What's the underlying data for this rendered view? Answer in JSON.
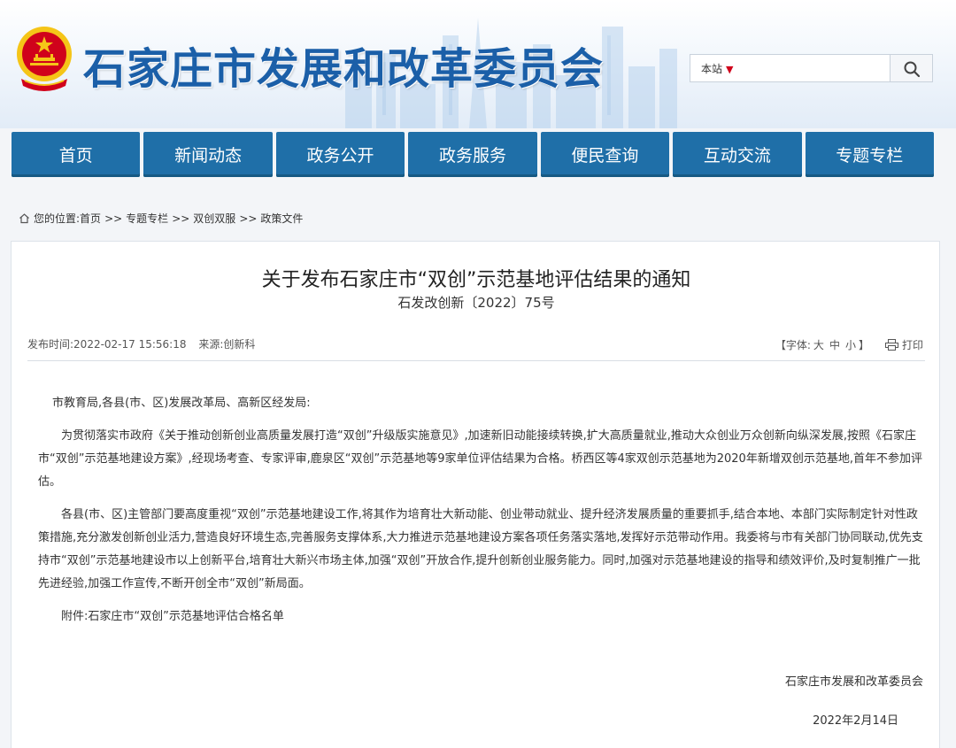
{
  "header": {
    "site_title": "石家庄市发展和改革委员会",
    "search": {
      "scope_label": "本站",
      "placeholder": ""
    }
  },
  "nav": {
    "items": [
      {
        "label": "首页"
      },
      {
        "label": "新闻动态"
      },
      {
        "label": "政务公开"
      },
      {
        "label": "政务服务"
      },
      {
        "label": "便民查询"
      },
      {
        "label": "互动交流"
      },
      {
        "label": "专题专栏"
      }
    ]
  },
  "breadcrumb": {
    "prefix": "您的位置:",
    "items": [
      "首页",
      "专题专栏",
      "双创双服",
      "政策文件"
    ],
    "separator": ">>"
  },
  "article": {
    "title": "关于发布石家庄市“双创”示范基地评估结果的通知",
    "doc_no": "石发改创新〔2022〕75号",
    "publish_time": "发布时间:2022-02-17  15:56:18",
    "source": "来源:创新科",
    "font_label_open": "【字体:",
    "font_sizes": [
      "大",
      "中",
      "小"
    ],
    "font_label_close": "】",
    "print_label": "打印",
    "paragraphs": [
      "市教育局,各县(市、区)发展改革局、高新区经发局:",
      "为贯彻落实市政府《关于推动创新创业高质量发展打造“双创”升级版实施意见》,加速新旧动能接续转换,扩大高质量就业,推动大众创业万众创新向纵深发展,按照《石家庄市“双创”示范基地建设方案》,经现场考查、专家评审,鹿泉区“双创”示范基地等9家单位评估结果为合格。桥西区等4家双创示范基地为2020年新增双创示范基地,首年不参加评估。",
      "各县(市、区)主管部门要高度重视“双创”示范基地建设工作,将其作为培育壮大新动能、创业带动就业、提升经济发展质量的重要抓手,结合本地、本部门实际制定针对性政策措施,充分激发创新创业活力,营造良好环境生态,完善服务支撑体系,大力推进示范基地建设方案各项任务落实落地,发挥好示范带动作用。我委将与市有关部门协同联动,优先支持市“双创”示范基地建设市以上创新平台,培育壮大新兴市场主体,加强“双创”开放合作,提升创新创业服务能力。同时,加强对示范基地建设的指导和绩效评价,及时复制推广一批先进经验,加强工作宣传,不断开创全市“双创”新局面。",
      "附件:石家庄市“双创”示范基地评估合格名单"
    ],
    "sign_org": "石家庄市发展和改革委员会",
    "sign_date": "2022年2月14日"
  },
  "icons": {
    "emblem": "national-emblem-icon",
    "search": "search-icon",
    "home": "home-icon",
    "print": "printer-icon",
    "caret": "caret-down-icon"
  },
  "colors": {
    "brand_blue": "#1b5fa8",
    "nav_blue": "#1f6fa8",
    "emblem_red": "#d0021b",
    "emblem_gold": "#f5c518"
  }
}
